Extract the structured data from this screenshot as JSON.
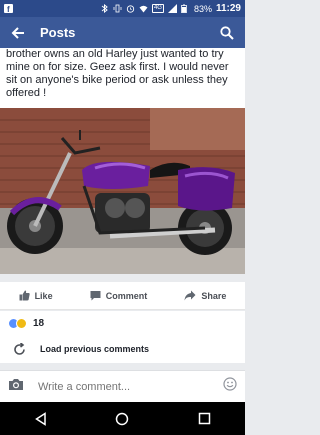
{
  "status_bar": {
    "battery": "83%",
    "time": "11:29",
    "network": "4G",
    "icons": [
      "facebook-icon",
      "bluetooth-icon",
      "vibrate-icon",
      "alarm-icon",
      "wifi-icon",
      "signal-icon",
      "battery-icon"
    ]
  },
  "app_bar": {
    "title": "Posts",
    "back_icon": "back-arrow-icon",
    "search_icon": "search-icon",
    "color": "#3b5998"
  },
  "post": {
    "text": "brother owns an old Harley just wanted to try mine on for size.  Geez ask first.  I would never sit on anyone's bike period or ask unless they offered !",
    "photo_icon": "motorcycle-photo"
  },
  "actions": {
    "like": "Like",
    "comment": "Comment",
    "share": "Share"
  },
  "reactions": {
    "count": "18",
    "types": [
      "like",
      "haha"
    ]
  },
  "comments": {
    "load_previous": "Load previous comments"
  },
  "composer": {
    "placeholder": "Write a comment..."
  }
}
